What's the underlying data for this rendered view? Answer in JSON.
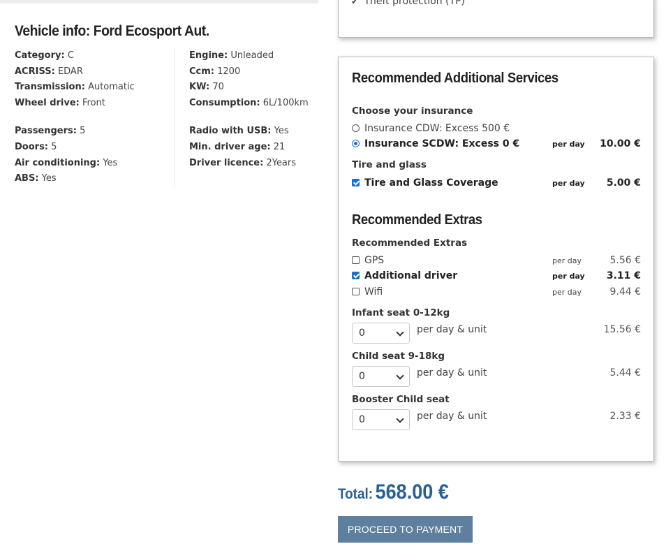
{
  "vehicle": {
    "title": "Vehicle info: Ford Ecosport Aut.",
    "left_group1": [
      {
        "label": "Category:",
        "value": "C"
      },
      {
        "label": "ACRISS:",
        "value": "EDAR"
      },
      {
        "label": "Transmission:",
        "value": "Automatic"
      },
      {
        "label": "Wheel drive:",
        "value": "Front"
      }
    ],
    "left_group2": [
      {
        "label": "Passengers:",
        "value": "5"
      },
      {
        "label": "Doors:",
        "value": "5"
      },
      {
        "label": "Air conditioning:",
        "value": "Yes"
      },
      {
        "label": "ABS:",
        "value": "Yes"
      }
    ],
    "right_group1": [
      {
        "label": "Engine:",
        "value": "Unleaded"
      },
      {
        "label": "Ccm:",
        "value": "1200"
      },
      {
        "label": "KW:",
        "value": "70"
      },
      {
        "label": "Consumption:",
        "value": "6L/100km"
      }
    ],
    "right_group2": [
      {
        "label": "Radio with USB:",
        "value": "Yes"
      },
      {
        "label": "Min. driver age:",
        "value": "21"
      },
      {
        "label": "Driver licence:",
        "value": "2Years"
      }
    ]
  },
  "protection": {
    "item": "Theft protection (TP)"
  },
  "services": {
    "heading": "Recommended Additional Services",
    "insurance_label": "Choose your insurance",
    "insurance_options": [
      {
        "label": "Insurance CDW: Excess 500 €",
        "selected": false,
        "per_day": "",
        "price": ""
      },
      {
        "label": "Insurance SCDW: Excess 0 €",
        "selected": true,
        "per_day": "per day",
        "price": "10.00 €"
      }
    ],
    "tire_label": "Tire and glass",
    "tire_option": {
      "label": "Tire and Glass Coverage",
      "checked": true,
      "per_day": "per day",
      "price": "5.00 €"
    },
    "extras_heading": "Recommended Extras",
    "extras_label": "Recommended Extras",
    "extras": [
      {
        "label": "GPS",
        "checked": false,
        "per_day": "per day",
        "price": "5.56 €"
      },
      {
        "label": "Additional driver",
        "checked": true,
        "per_day": "per day",
        "price": "3.11 €"
      },
      {
        "label": "Wifi",
        "checked": false,
        "per_day": "per day",
        "price": "9.44 €"
      }
    ],
    "seats": [
      {
        "label": "Infant seat 0-12kg",
        "value": "0",
        "unit": "per day & unit",
        "price": "15.56 €"
      },
      {
        "label": "Child seat 9-18kg",
        "value": "0",
        "unit": "per day & unit",
        "price": "5.44 €"
      },
      {
        "label": "Booster Child seat",
        "value": "0",
        "unit": "per day & unit",
        "price": "2.33 €"
      }
    ]
  },
  "total": {
    "label": "Total:",
    "amount": "568.00 €"
  },
  "payment_button": "PROCEED TO PAYMENT",
  "colors": {
    "accent": "#1a6fd0",
    "total_text": "#2a5f96",
    "button_bg": "#5e7f9d"
  }
}
